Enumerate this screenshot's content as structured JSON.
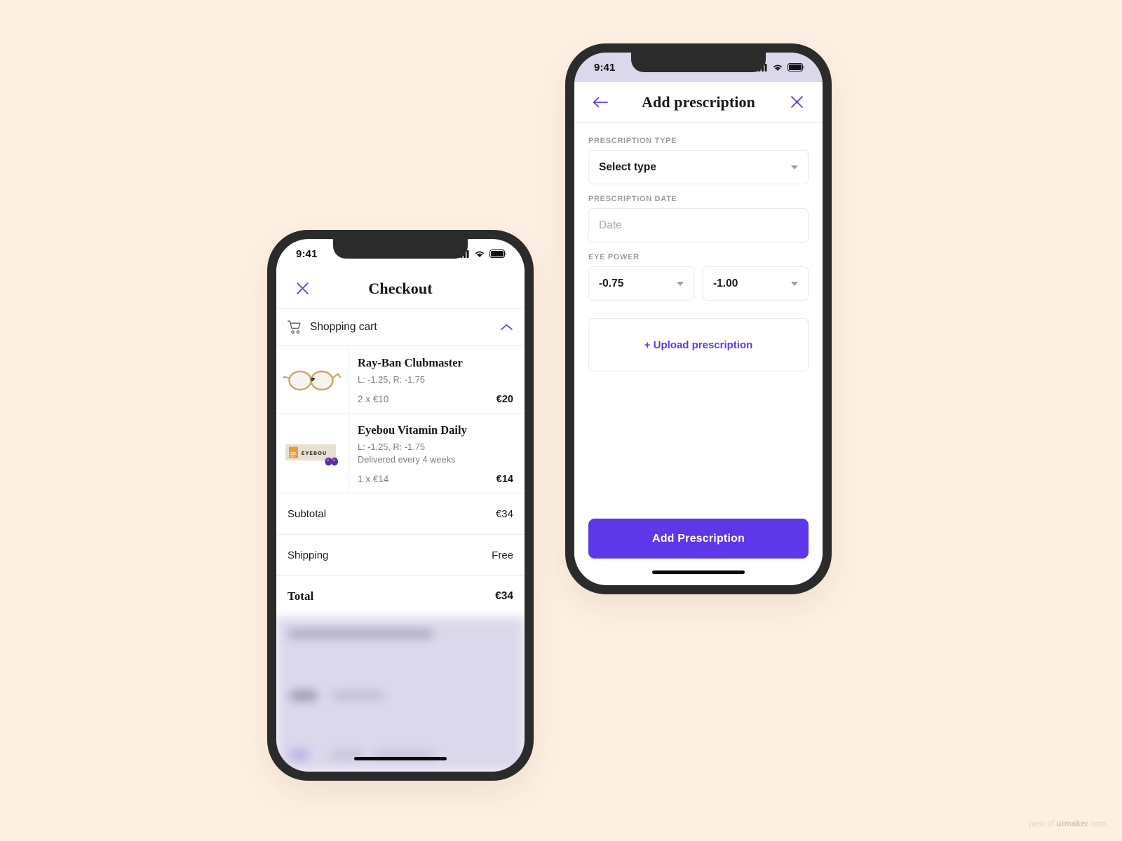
{
  "canvas": {
    "background": "#FDF0E2"
  },
  "theme": {
    "accent_purple": "#5D38E8",
    "lavender": "#DCD8EC",
    "cream": "#FDF0E2",
    "frame_dark": "#2B2B2B"
  },
  "watermark": {
    "prefix": "post of ",
    "brand": "uimaker",
    "suffix": ".com"
  },
  "left_phone": {
    "status_bar": {
      "time": "9:41",
      "icons": [
        "cellular-signal-icon",
        "wifi-icon",
        "battery-icon"
      ]
    },
    "nav": {
      "close_label": "close-icon",
      "title": "Checkout"
    },
    "cart_section": {
      "icon": "shopping-cart-icon",
      "label": "Shopping cart",
      "collapse_icon": "chevron-up-icon",
      "expanded": true
    },
    "items": [
      {
        "thumb": "eyeglasses-image",
        "title": "Ray-Ban Clubmaster",
        "prescription": "L: -1.25, R: -1.75",
        "delivery": "",
        "qty_price": "2 x €10",
        "line_total": "€20"
      },
      {
        "thumb": "vitamin-box-image",
        "title": "Eyebou Vitamin Daily",
        "prescription": "L: -1.25, R: -1.75",
        "delivery": "Delivered every 4 weeks",
        "qty_price": "1 x €14",
        "line_total": "€14"
      }
    ],
    "totals": [
      {
        "label": "Subtotal",
        "value": "€34",
        "grand": false
      },
      {
        "label": "Shipping",
        "value": "Free",
        "grand": false
      },
      {
        "label": "Total",
        "value": "€34",
        "grand": true
      }
    ],
    "payment_panel": {
      "state": "blurred",
      "background": "#DCD8EC"
    }
  },
  "right_phone": {
    "status_bar": {
      "time": "9:41",
      "icons": [
        "cellular-signal-icon",
        "wifi-icon",
        "battery-icon"
      ]
    },
    "nav": {
      "back_label": "back-arrow-icon",
      "title": "Add prescription",
      "close_label": "close-icon"
    },
    "form": {
      "type_label": "PRESCRIPTION TYPE",
      "type_value": "Select type",
      "date_label": "PRESCRIPTION DATE",
      "date_placeholder": "Date",
      "eye_power_label": "EYE POWER",
      "eye_left_value": "-0.75",
      "eye_right_value": "-1.00",
      "upload_label": "+ Upload prescription"
    },
    "cta": {
      "label": "Add Prescription"
    }
  }
}
